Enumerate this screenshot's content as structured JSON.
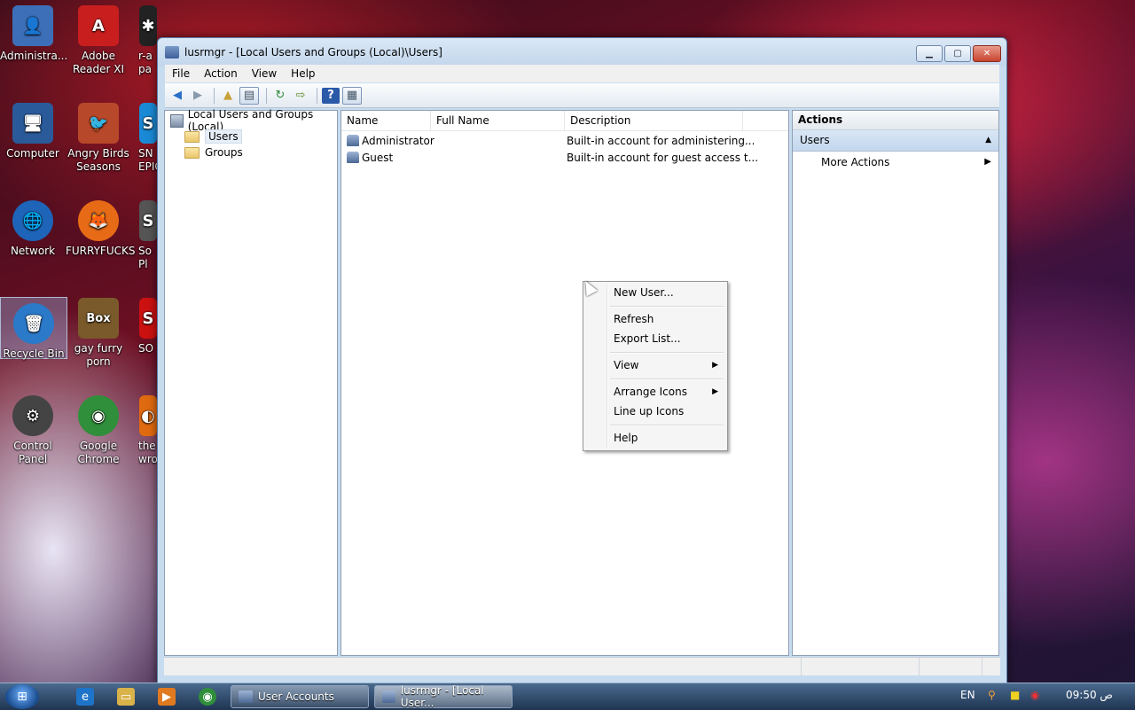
{
  "desktop": {
    "icons": [
      {
        "label": "Administra...",
        "glyph": "👤",
        "color": "#3d6fb8"
      },
      {
        "label": "Adobe Reader XI",
        "glyph": "A",
        "color": "#c81e1e"
      },
      {
        "label": "r-a pa",
        "glyph": "✱",
        "color": "#222"
      },
      {
        "label": "Computer",
        "glyph": "🖥",
        "color": "#2a5a9a"
      },
      {
        "label": "Angry Birds Seasons",
        "glyph": "🐦",
        "color": "#b8482a"
      },
      {
        "label": "SN EPIC",
        "glyph": "S",
        "color": "#1a8ad6"
      },
      {
        "label": "Network",
        "glyph": "🌐",
        "color": "#1e64b8"
      },
      {
        "label": "FURRYFUCKS",
        "glyph": "🦊",
        "color": "#e76b16"
      },
      {
        "label": "So Pl",
        "glyph": "S",
        "color": "#555"
      },
      {
        "label": "Recycle Bin",
        "glyph": "🗑",
        "color": "#2b79c9"
      },
      {
        "label": "gay furry porn",
        "glyph": "Box",
        "color": "#7a5a2a"
      },
      {
        "label": "SO",
        "glyph": "S",
        "color": "#c11"
      },
      {
        "label": "Control Panel",
        "glyph": "⚙",
        "color": "#444"
      },
      {
        "label": "Google Chrome",
        "glyph": "◉",
        "color": "#2f8f3a"
      },
      {
        "label": "the wron",
        "glyph": "◐",
        "color": "#e06a10"
      }
    ]
  },
  "window": {
    "title": "lusrmgr - [Local Users and Groups (Local)\\Users]",
    "menu": [
      "File",
      "Action",
      "View",
      "Help"
    ],
    "tree": {
      "root": "Local Users and Groups (Local)",
      "children": [
        "Users",
        "Groups"
      ]
    },
    "list": {
      "columns": [
        "Name",
        "Full Name",
        "Description"
      ],
      "rows": [
        {
          "name": "Administrator",
          "full_name": "",
          "description": "Built-in account for administering..."
        },
        {
          "name": "Guest",
          "full_name": "",
          "description": "Built-in account for guest access t..."
        }
      ]
    },
    "actions": {
      "header": "Actions",
      "section": "Users",
      "item": "More Actions"
    }
  },
  "context_menu": {
    "items": [
      "New User...",
      "Refresh",
      "Export List...",
      "View",
      "Arrange Icons",
      "Line up Icons",
      "Help"
    ]
  },
  "taskbar": {
    "tasks": [
      "User Accounts",
      "lusrmgr - [Local User..."
    ],
    "lang": "EN",
    "clock": "09:50 ص"
  }
}
